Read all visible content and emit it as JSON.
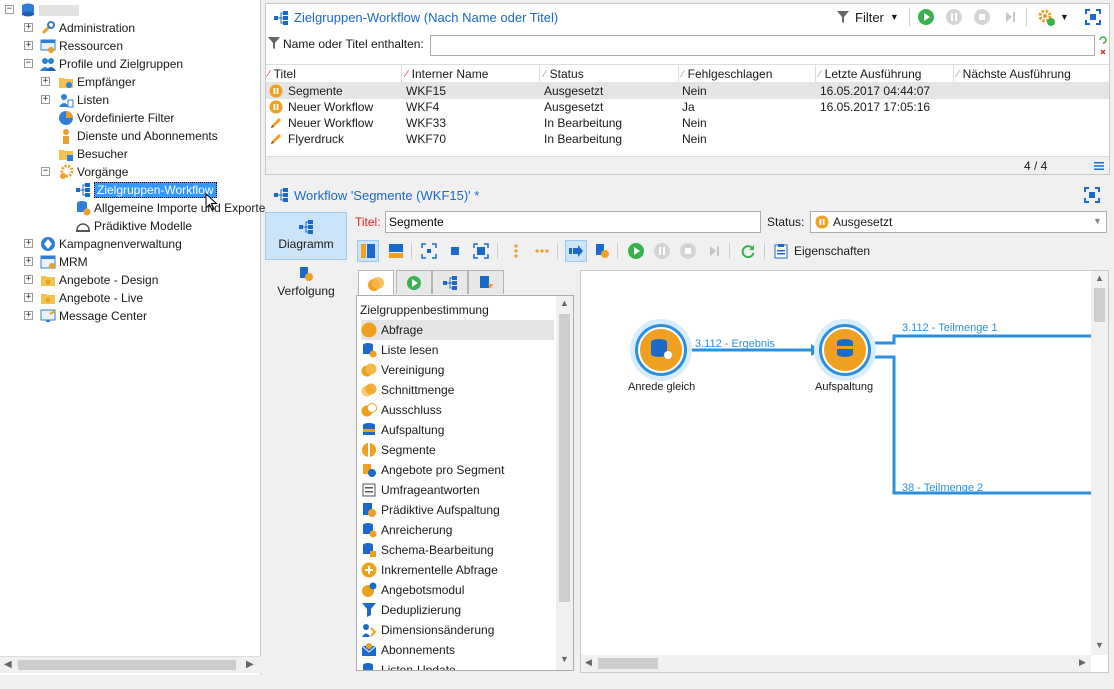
{
  "tree": {
    "root_label": "",
    "items": [
      {
        "label": "Administration"
      },
      {
        "label": "Ressourcen"
      },
      {
        "label": "Profile und Zielgruppen"
      },
      {
        "label": "Empfänger"
      },
      {
        "label": "Listen"
      },
      {
        "label": "Vordefinierte Filter"
      },
      {
        "label": "Dienste und Abonnements"
      },
      {
        "label": "Besucher"
      },
      {
        "label": "Vorgänge"
      },
      {
        "label": "Zielgruppen-Workflow"
      },
      {
        "label": "Allgemeine Importe und Exporte"
      },
      {
        "label": "Prädiktive Modelle"
      },
      {
        "label": "Kampagnenverwaltung"
      },
      {
        "label": "MRM"
      },
      {
        "label": "Angebote - Design"
      },
      {
        "label": "Angebote - Live"
      },
      {
        "label": "Message Center"
      }
    ]
  },
  "list_panel": {
    "title": "Zielgruppen-Workflow (Nach Name oder Titel)",
    "filter_label": "Filter",
    "search_label": "Name oder Titel enthalten:",
    "search_value": "",
    "columns": [
      "Titel",
      "Interner Name",
      "Status",
      "Fehlgeschlagen",
      "Letzte Ausführung",
      "Nächste Ausführung"
    ],
    "rows": [
      {
        "title": "Segmente",
        "internal": "WKF15",
        "status": "Ausgesetzt",
        "failed": "Nein",
        "last_run": "16.05.2017 04:44:07",
        "next_run": "",
        "icon": "pause-icon"
      },
      {
        "title": "Neuer Workflow",
        "internal": "WKF4",
        "status": "Ausgesetzt",
        "failed": "Ja",
        "last_run": "16.05.2017 17:05:16",
        "next_run": "",
        "icon": "pause-icon"
      },
      {
        "title": "Neuer Workflow",
        "internal": "WKF33",
        "status": "In Bearbeitung",
        "failed": "Nein",
        "last_run": "",
        "next_run": "",
        "icon": "pencil-icon"
      },
      {
        "title": "Flyerdruck",
        "internal": "WKF70",
        "status": "In Bearbeitung",
        "failed": "Nein",
        "last_run": "",
        "next_run": "",
        "icon": "pencil-icon"
      }
    ],
    "count": "4 / 4"
  },
  "editor": {
    "title": "Workflow 'Segmente (WKF15)' *",
    "side_tabs": [
      "Diagramm",
      "Verfolgung"
    ],
    "titel_label": "Titel:",
    "titel_value": "Segmente",
    "status_label": "Status:",
    "status_value": "Ausgesetzt",
    "properties_label": "Eigenschaften"
  },
  "palette": {
    "header": "Zielgruppenbestimmung",
    "items": [
      {
        "label": "Abfrage",
        "icon": "query-icon"
      },
      {
        "label": "Liste lesen",
        "icon": "read-list-icon"
      },
      {
        "label": "Vereinigung",
        "icon": "union-icon"
      },
      {
        "label": "Schnittmenge",
        "icon": "intersection-icon"
      },
      {
        "label": "Ausschluss",
        "icon": "exclusion-icon"
      },
      {
        "label": "Aufspaltung",
        "icon": "split-icon"
      },
      {
        "label": "Segmente",
        "icon": "segments-icon"
      },
      {
        "label": "Angebote pro Segment",
        "icon": "offers-per-segment-icon"
      },
      {
        "label": "Umfrageantworten",
        "icon": "survey-icon"
      },
      {
        "label": "Prädiktive Aufspaltung",
        "icon": "predictive-split-icon"
      },
      {
        "label": "Anreicherung",
        "icon": "enrichment-icon"
      },
      {
        "label": "Schema-Bearbeitung",
        "icon": "schema-edit-icon"
      },
      {
        "label": "Inkrementelle Abfrage",
        "icon": "incremental-query-icon"
      },
      {
        "label": "Angebotsmodul",
        "icon": "offer-engine-icon"
      },
      {
        "label": "Deduplizierung",
        "icon": "dedup-icon"
      },
      {
        "label": "Dimensionsänderung",
        "icon": "dimension-change-icon"
      },
      {
        "label": "Abonnements",
        "icon": "subscriptions-icon"
      },
      {
        "label": "Listen-Update",
        "icon": "list-update-icon"
      }
    ]
  },
  "diagram": {
    "nodes": [
      {
        "label": "Anrede gleich",
        "icon": "query-icon"
      },
      {
        "label": "Aufspaltung",
        "icon": "split-icon"
      }
    ],
    "edges": [
      {
        "label": "3.112 - Ergebnis"
      },
      {
        "label": "3.112 - Teilmenge 1"
      },
      {
        "label": "38 - Teilmenge 2"
      }
    ]
  },
  "colors": {
    "accent_blue": "#1b6ac9",
    "transition_blue": "#2b8fe0",
    "node_orange": "#f5a623",
    "selection_blue": "#3399ff"
  }
}
